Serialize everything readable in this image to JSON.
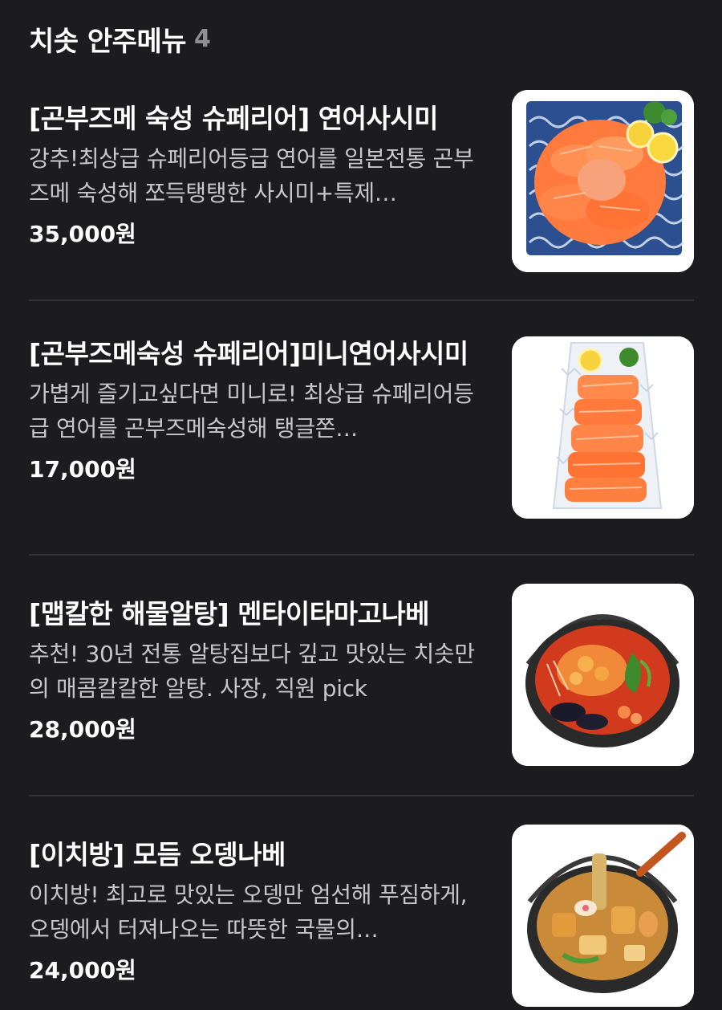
{
  "section": {
    "title": "치솟 안주메뉴",
    "count": "4"
  },
  "menu_items": [
    {
      "name": "[곤부즈메 숙성 슈페리어] 연어사시미",
      "description": "강추!최상급 슈페리어등급 연어를 일본전통 곤부즈메 숙성해 쪼득탱탱한 사시미+특제…",
      "price": "35,000원"
    },
    {
      "name": "[곤부즈메숙성 슈페리어]미니연어사시미",
      "description": "가볍게 즐기고싶다면 미니로! 최상급 슈페리어등급 연어를 곤부즈메숙성해 탱글쫀…",
      "price": "17,000원"
    },
    {
      "name": "[맵칼한 해물알탕] 멘타이타마고나베",
      "description": "추천! 30년 전통 알탕집보다 깊고 맛있는 치솟만의 매콤칼칼한 알탕. 사장, 직원 pick",
      "price": "28,000원"
    },
    {
      "name": "[이치방] 모듬 오뎅나베",
      "description": "이치방! 최고로 맛있는 오뎅만 엄선해 푸짐하게, 오뎅에서 터져나오는 따뜻한 국물의…",
      "price": "24,000원"
    }
  ]
}
